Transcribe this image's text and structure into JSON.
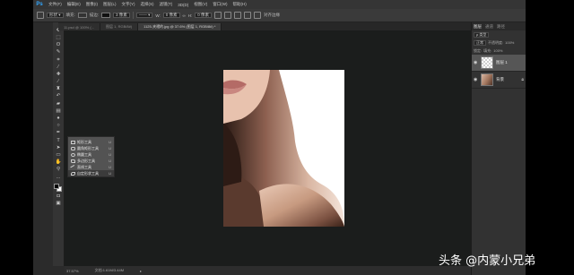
{
  "app": {
    "logo": "Ps"
  },
  "menubar": {
    "items": [
      "文件(F)",
      "编辑(E)",
      "图像(I)",
      "图层(L)",
      "文字(Y)",
      "选择(S)",
      "滤镜(T)",
      "3D(D)",
      "视图(V)",
      "窗口(W)",
      "帮助(H)"
    ]
  },
  "options": {
    "fill_label": "填充:",
    "stroke_label": "描边:",
    "stroke_width": "3 像素",
    "w_label": "W:",
    "w_value": "0 像素",
    "h_label": "H:",
    "h_value": "0 像素",
    "align_edges": "对齐边缘"
  },
  "tabs": [
    {
      "label": "11.psd @ 100% (...",
      "active": false
    },
    {
      "label": "图层 1, RGB/8#)",
      "active": false
    },
    {
      "label": "1125-夹褶的.jpg @ 37.6% (图层 1, RGB/8#) *",
      "active": true
    }
  ],
  "toolbar": {
    "tools": [
      {
        "name": "move-tool-icon",
        "glyph": "✥"
      },
      {
        "name": "marquee-tool-icon",
        "glyph": "⬚"
      },
      {
        "name": "lasso-tool-icon",
        "glyph": "ʘ"
      },
      {
        "name": "quick-select-tool-icon",
        "glyph": "✎"
      },
      {
        "name": "crop-tool-icon",
        "glyph": "⌗"
      },
      {
        "name": "eyedropper-tool-icon",
        "glyph": "⁄"
      },
      {
        "name": "healing-brush-tool-icon",
        "glyph": "✚"
      },
      {
        "name": "brush-tool-icon",
        "glyph": "∕"
      },
      {
        "name": "clone-stamp-tool-icon",
        "glyph": "♜"
      },
      {
        "name": "history-brush-tool-icon",
        "glyph": "↶"
      },
      {
        "name": "eraser-tool-icon",
        "glyph": "▰"
      },
      {
        "name": "gradient-tool-icon",
        "glyph": "▤"
      },
      {
        "name": "blur-tool-icon",
        "glyph": "●"
      },
      {
        "name": "dodge-tool-icon",
        "glyph": "○"
      },
      {
        "name": "pen-tool-icon",
        "glyph": "✒"
      },
      {
        "name": "type-tool-icon",
        "glyph": "T"
      },
      {
        "name": "path-select-tool-icon",
        "glyph": "➤"
      },
      {
        "name": "rectangle-tool-icon",
        "glyph": "▭"
      },
      {
        "name": "hand-tool-icon",
        "glyph": "✋"
      },
      {
        "name": "zoom-tool-icon",
        "glyph": "⚲"
      },
      {
        "name": "more-tools-icon",
        "glyph": "…"
      }
    ]
  },
  "flyout": {
    "items": [
      {
        "label": "矩形工具",
        "key": "U",
        "current": false
      },
      {
        "label": "圆角矩形工具",
        "key": "U",
        "current": false
      },
      {
        "label": "椭圆工具",
        "key": "U",
        "current": false
      },
      {
        "label": "多边形工具",
        "key": "U",
        "current": false
      },
      {
        "label": "直线工具",
        "key": "U",
        "current": false
      },
      {
        "label": "自定形状工具",
        "key": "U",
        "current": true
      }
    ]
  },
  "status": {
    "zoom": "37.57%",
    "doc_size": "文档:1.61M/3.44M"
  },
  "panels": {
    "tabs": [
      "图层",
      "通道",
      "路径"
    ],
    "kind_label": "ρ 类型",
    "blend_mode": "正常",
    "opacity_label": "不透明度:",
    "opacity_value": "100%",
    "lock_label": "锁定:",
    "fill_label": "填充:",
    "fill_value": "100%",
    "layers": [
      {
        "name": "图层 1",
        "selected": true
      },
      {
        "name": "背景",
        "selected": false
      }
    ]
  },
  "watermark": "头条 @内蒙小兄弟"
}
